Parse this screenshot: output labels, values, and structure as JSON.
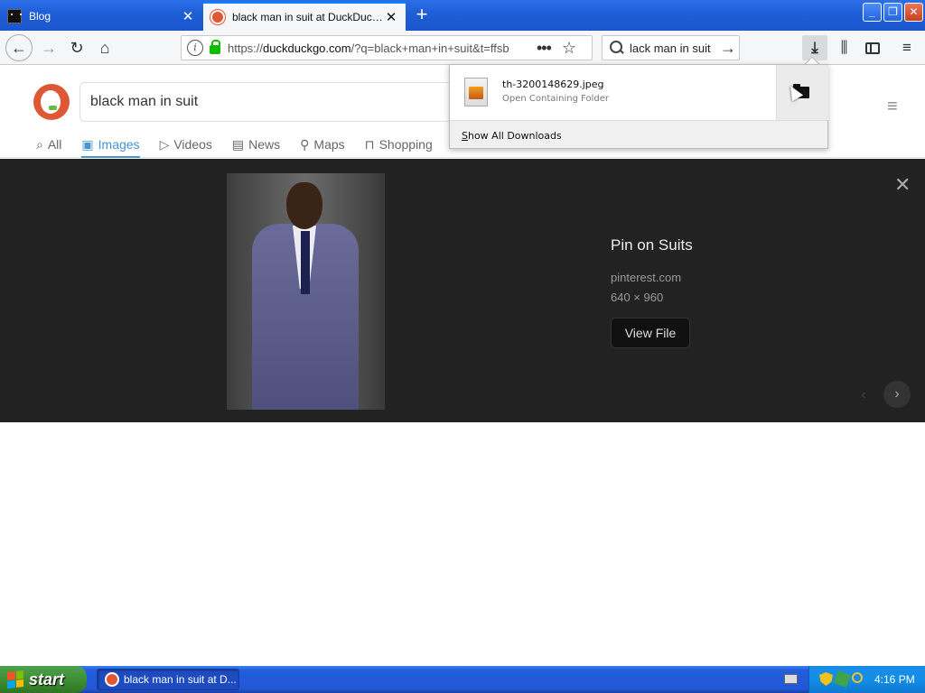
{
  "browser": {
    "tabs": [
      {
        "title": "Blog",
        "active": false,
        "favicon": "blog-favicon"
      },
      {
        "title": "black man in suit at DuckDuckGo",
        "active": true,
        "favicon": "duckduckgo-favicon"
      }
    ],
    "window_controls": {
      "minimize": "_",
      "maximize": "❐",
      "close": "✕"
    },
    "url": {
      "prefix": "https://",
      "host": "duckduckgo.com",
      "rest": "/?q=black+man+in+suit&t=ffsb"
    },
    "search_box": {
      "value": "lack man in suit"
    },
    "icons": {
      "back": "←",
      "forward": "→",
      "reload": "↻",
      "home": "⌂",
      "more": "•••",
      "star": "☆",
      "go": "→",
      "download": "⤓",
      "library": "⫼",
      "menu": "≡",
      "new_tab": "+",
      "close_tab": "✕"
    }
  },
  "downloads": {
    "file_name": "th-3200148629.jpeg",
    "status": "Open Containing Folder",
    "show_all": "Show All Downloads"
  },
  "ddg": {
    "query": "black man in suit",
    "tabs": [
      {
        "label": "All",
        "icon": "search-icon",
        "glyph": "⌕",
        "active": false
      },
      {
        "label": "Images",
        "icon": "image-icon",
        "glyph": "▣",
        "active": true
      },
      {
        "label": "Videos",
        "icon": "play-icon",
        "glyph": "▷",
        "active": false
      },
      {
        "label": "News",
        "icon": "news-icon",
        "glyph": "▤",
        "active": false
      },
      {
        "label": "Maps",
        "icon": "map-pin-icon",
        "glyph": "⚲",
        "active": false
      },
      {
        "label": "Shopping",
        "icon": "shopping-bag-icon",
        "glyph": "⊓",
        "active": false
      }
    ],
    "menu_glyph": "≡"
  },
  "detail": {
    "title": "Pin on Suits",
    "source": "pinterest.com",
    "dimensions": "640 × 960",
    "view_button": "View File",
    "close_glyph": "✕",
    "prev_glyph": "‹",
    "next_glyph": "›"
  },
  "taskbar": {
    "start_label": "start",
    "task_title": "black man in suit at D...",
    "clock": "4:16 PM"
  },
  "colors": {
    "accent": "#4495d4",
    "ddg_orange": "#de5833",
    "detail_bg": "#222222",
    "xp_blue": "#245edb"
  }
}
